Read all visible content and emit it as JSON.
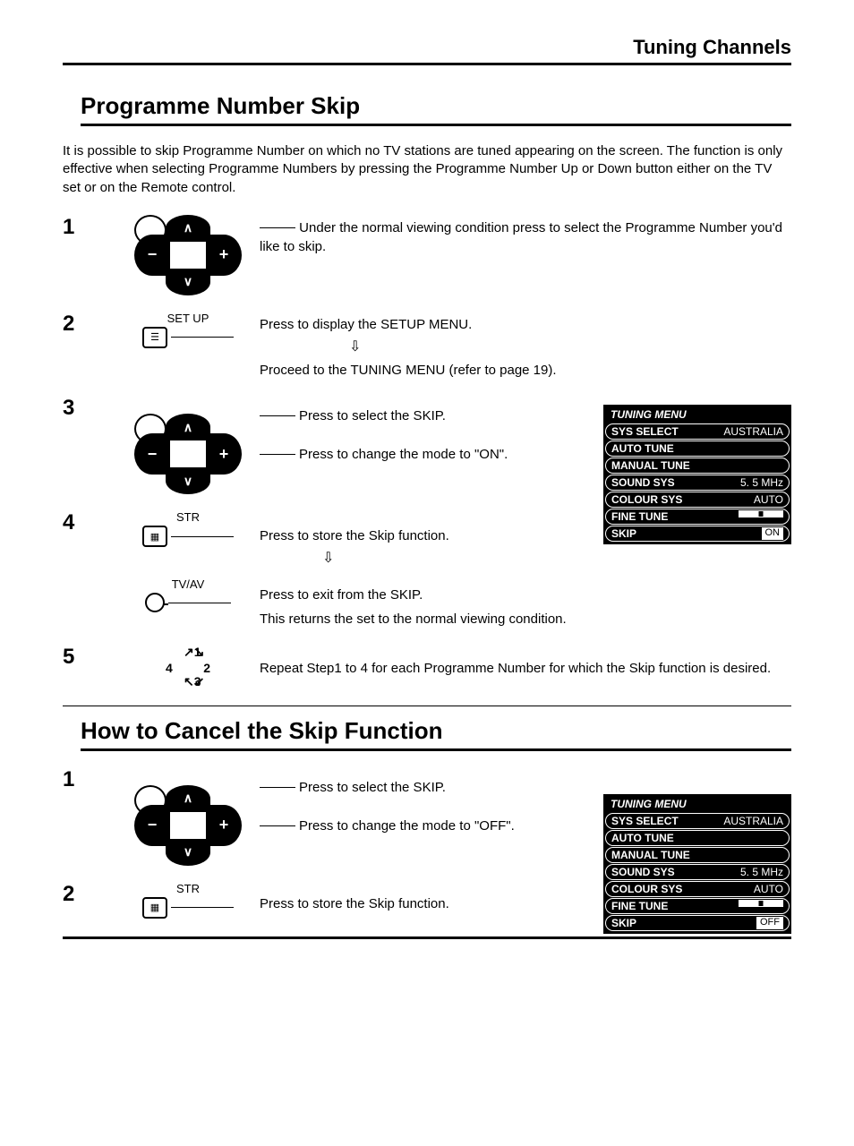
{
  "header": {
    "title": "Tuning Channels"
  },
  "section1": {
    "title": "Programme Number Skip",
    "intro": "It is possible to skip Programme Number on which no TV stations are tuned appearing on the screen. The function is only effective when selecting Programme Numbers by pressing the Programme Number Up or Down button either on the TV set or on the Remote control."
  },
  "steps": {
    "s1": {
      "num": "1",
      "text": "Under the normal viewing condition press to select the Programme Number you'd like to skip."
    },
    "s2": {
      "num": "2",
      "label": "SET UP",
      "text1": "Press to display the SETUP MENU.",
      "text2": "Proceed to the TUNING MENU (refer to page 19)."
    },
    "s3": {
      "num": "3",
      "text1": "Press to select the SKIP.",
      "text2": "Press to change the mode to \"ON\"."
    },
    "s4": {
      "num": "4",
      "label1": "STR",
      "text1": "Press to store the Skip function.",
      "label2": "TV/AV",
      "text2": "Press to exit from  the SKIP.",
      "text3": "This returns the set to the normal viewing condition."
    },
    "s5": {
      "num": "5",
      "text": "Repeat Step1 to 4 for each Programme Number for which the Skip function is desired."
    }
  },
  "menu1": {
    "title": "TUNING MENU",
    "rows": [
      {
        "label": "SYS SELECT",
        "value": "AUSTRALIA"
      },
      {
        "label": "AUTO TUNE",
        "value": ""
      },
      {
        "label": "MANUAL TUNE",
        "value": ""
      },
      {
        "label": "SOUND SYS",
        "value": "5. 5 MHz"
      },
      {
        "label": "COLOUR SYS",
        "value": "AUTO"
      },
      {
        "label": "FINE TUNE",
        "value": "slider"
      },
      {
        "label": "SKIP",
        "value": "ON"
      }
    ]
  },
  "section2": {
    "title": "How to Cancel the Skip Function"
  },
  "cancel": {
    "s1": {
      "num": "1",
      "text1": "Press to select the SKIP.",
      "text2": "Press to change the mode to \"OFF\"."
    },
    "s2": {
      "num": "2",
      "label": "STR",
      "text": "Press to store the Skip function."
    }
  },
  "menu2": {
    "title": "TUNING MENU",
    "rows": [
      {
        "label": "SYS SELECT",
        "value": "AUSTRALIA"
      },
      {
        "label": "AUTO TUNE",
        "value": ""
      },
      {
        "label": "MANUAL TUNE",
        "value": ""
      },
      {
        "label": "SOUND SYS",
        "value": "5. 5 MHz"
      },
      {
        "label": "COLOUR SYS",
        "value": "AUTO"
      },
      {
        "label": "FINE TUNE",
        "value": "slider"
      },
      {
        "label": "SKIP",
        "value": "OFF"
      }
    ]
  },
  "repeat": {
    "n1": "1",
    "n2": "2",
    "n3": "3",
    "n4": "4"
  }
}
